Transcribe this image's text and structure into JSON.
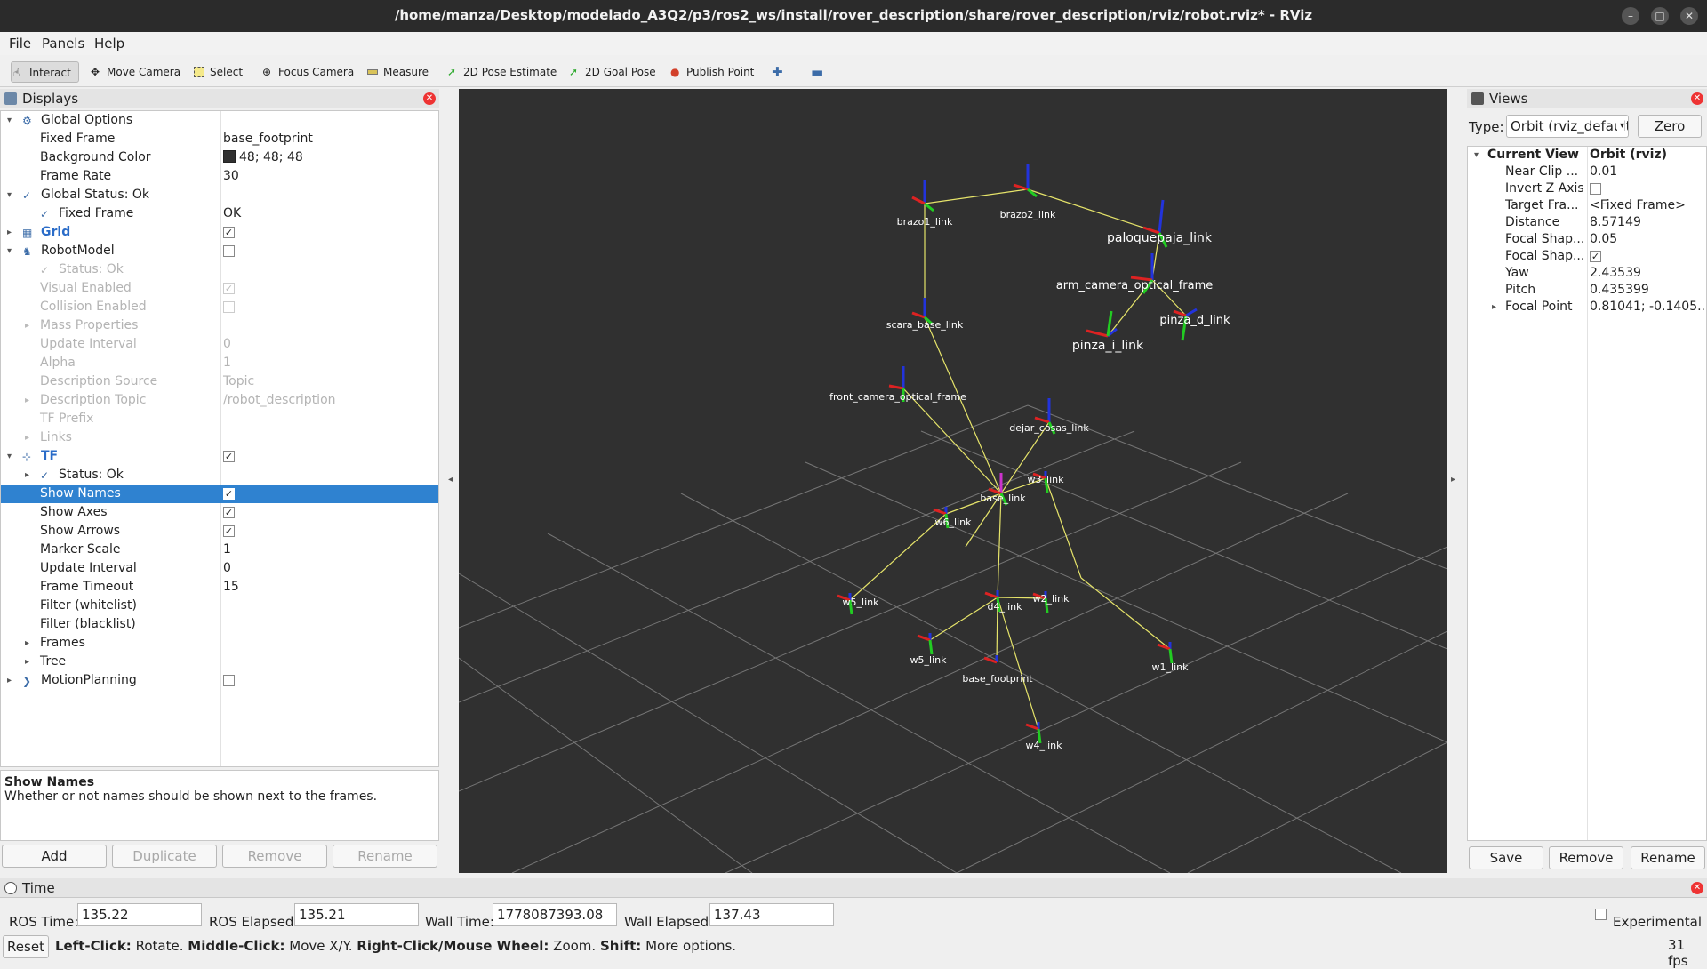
{
  "window": {
    "title": "/home/manza/Desktop/modelado_A3Q2/p3/ros2_ws/install/rover_description/share/rover_description/rviz/robot.rviz* - RViz"
  },
  "menu": {
    "file": "File",
    "panels": "Panels",
    "help": "Help"
  },
  "toolbar": {
    "interact": "Interact",
    "move_camera": "Move Camera",
    "select": "Select",
    "focus_camera": "Focus Camera",
    "measure": "Measure",
    "pose_estimate": "2D Pose Estimate",
    "goal_pose": "2D Goal Pose",
    "publish_point": "Publish Point"
  },
  "displays": {
    "title": "Displays",
    "rows": [
      {
        "name": "Global Options",
        "value": ""
      },
      {
        "name": "Fixed Frame",
        "value": "base_footprint"
      },
      {
        "name": "Background Color",
        "value": "48; 48; 48"
      },
      {
        "name": "Frame Rate",
        "value": "30"
      },
      {
        "name": "Global Status: Ok",
        "value": ""
      },
      {
        "name": "Fixed Frame",
        "value": "OK"
      },
      {
        "name": "Grid",
        "value": ""
      },
      {
        "name": "RobotModel",
        "value": ""
      },
      {
        "name": "Status: Ok",
        "value": ""
      },
      {
        "name": "Visual Enabled",
        "value": ""
      },
      {
        "name": "Collision Enabled",
        "value": ""
      },
      {
        "name": "Mass Properties",
        "value": ""
      },
      {
        "name": "Update Interval",
        "value": "0"
      },
      {
        "name": "Alpha",
        "value": "1"
      },
      {
        "name": "Description Source",
        "value": "Topic"
      },
      {
        "name": "Description Topic",
        "value": "/robot_description"
      },
      {
        "name": "TF Prefix",
        "value": ""
      },
      {
        "name": "Links",
        "value": ""
      },
      {
        "name": "TF",
        "value": ""
      },
      {
        "name": "Status: Ok",
        "value": ""
      },
      {
        "name": "Show Names",
        "value": ""
      },
      {
        "name": "Show Axes",
        "value": ""
      },
      {
        "name": "Show Arrows",
        "value": ""
      },
      {
        "name": "Marker Scale",
        "value": "1"
      },
      {
        "name": "Update Interval",
        "value": "0"
      },
      {
        "name": "Frame Timeout",
        "value": "15"
      },
      {
        "name": "Filter (whitelist)",
        "value": ""
      },
      {
        "name": "Filter (blacklist)",
        "value": ""
      },
      {
        "name": "Frames",
        "value": ""
      },
      {
        "name": "Tree",
        "value": ""
      },
      {
        "name": "MotionPlanning",
        "value": ""
      }
    ],
    "desc_title": "Show Names",
    "desc_text": "Whether or not names should be shown next to the frames.",
    "buttons": {
      "add": "Add",
      "duplicate": "Duplicate",
      "remove": "Remove",
      "rename": "Rename"
    }
  },
  "viewport": {
    "background": "#303030",
    "frame_labels": [
      "brazo1_link",
      "brazo2_link",
      "paloquepaja_link",
      "arm_camera_optical_frame",
      "pinza_d_link",
      "pinza_i_link",
      "scara_base_link",
      "front_camera_optical_frame",
      "dejar_cosas_link",
      "base_link",
      "w3_link",
      "w6_link",
      "w5_link",
      "d4_link",
      "w2_link",
      "w5_link",
      "w1_link",
      "base_footprint",
      "w4_link"
    ]
  },
  "views": {
    "title": "Views",
    "type_label": "Type:",
    "type_value": "Orbit (rviz_default_plugins)",
    "zero": "Zero",
    "current_view": "Current View",
    "current_view_type": "Orbit (rviz)",
    "props": [
      {
        "name": "Near Clip ...",
        "value": "0.01"
      },
      {
        "name": "Invert Z Axis",
        "value": ""
      },
      {
        "name": "Target Fra...",
        "value": "<Fixed Frame>"
      },
      {
        "name": "Distance",
        "value": "8.57149"
      },
      {
        "name": "Focal Shap...",
        "value": "0.05"
      },
      {
        "name": "Focal Shap...",
        "value": ""
      },
      {
        "name": "Yaw",
        "value": "2.43539"
      },
      {
        "name": "Pitch",
        "value": "0.435399"
      },
      {
        "name": "Focal Point",
        "value": "0.81041; -0.1405..."
      }
    ],
    "buttons": {
      "save": "Save",
      "remove": "Remove",
      "rename": "Rename"
    }
  },
  "time": {
    "title": "Time",
    "ros_time_label": "ROS Time:",
    "ros_time": "135.22",
    "ros_elapsed_label": "ROS Elapsed:",
    "ros_elapsed": "135.21",
    "wall_time_label": "Wall Time:",
    "wall_time": "1778087393.08",
    "wall_elapsed_label": "Wall Elapsed:",
    "wall_elapsed": "137.43",
    "experimental": "Experimental",
    "reset": "Reset",
    "hint": {
      "k1": "Left-Click:",
      "v1": "Rotate.",
      "k2": "Middle-Click:",
      "v2": "Move X/Y.",
      "k3": "Right-Click/Mouse Wheel:",
      "v3": "Zoom.",
      "k4": "Shift:",
      "v4": "More options."
    },
    "fps": "31 fps"
  }
}
